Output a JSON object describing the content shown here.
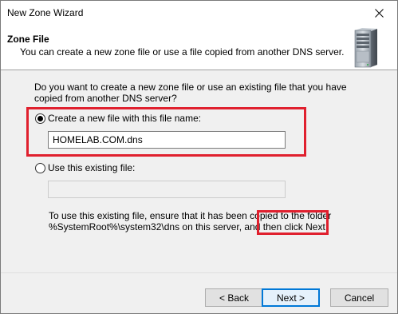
{
  "window": {
    "title": "New Zone Wizard"
  },
  "header": {
    "title": "Zone File",
    "subtitle": "You can create a new zone file or use a file copied from another DNS server."
  },
  "body": {
    "question": "Do you want to create a new zone file or use an existing file that you have copied from another DNS server?",
    "create_option": {
      "label": "Create a new file with this file name:",
      "selected": true
    },
    "file_name_value": "HOMELAB.COM.dns",
    "existing_option": {
      "label": "Use this existing file:",
      "selected": false
    },
    "existing_file_value": "",
    "note": "To use this existing file, ensure that it has been copied to the folder %SystemRoot%\\system32\\dns on this server, and then click Next."
  },
  "footer": {
    "back_label": "< Back",
    "next_label": "Next >",
    "cancel_label": "Cancel"
  },
  "colors": {
    "highlight": "#e0202e",
    "default_button_border": "#0078d7",
    "dialog_background": "#f0f0f0"
  }
}
